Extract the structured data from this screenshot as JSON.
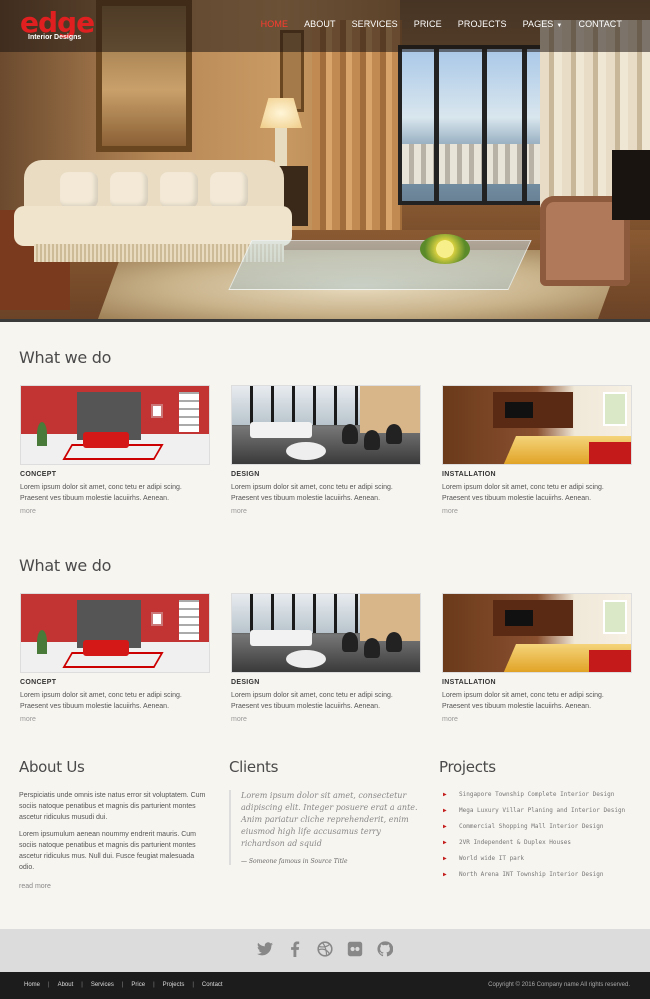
{
  "header": {
    "logo_main": "edge",
    "logo_sub": "Interior Designs",
    "nav": [
      {
        "label": "HOME",
        "active": true
      },
      {
        "label": "ABOUT",
        "active": false
      },
      {
        "label": "SERVICES",
        "active": false
      },
      {
        "label": "PRICE",
        "active": false
      },
      {
        "label": "PROJECTS",
        "active": false
      },
      {
        "label": "PAGES",
        "active": false,
        "dropdown": true
      },
      {
        "label": "CONTACT",
        "active": false
      }
    ]
  },
  "sections": [
    {
      "title": "What we do",
      "cards": [
        {
          "heading": "CONCEPT",
          "text": "Lorem ipsum dolor sit amet, conc tetu er adipi scing. Praesent ves tibuum molestie lacuiirhs. Aenean.",
          "more": "more"
        },
        {
          "heading": "DESIGN",
          "text": "Lorem ipsum dolor sit amet, conc tetu er adipi scing. Praesent ves tibuum molestie lacuiirhs. Aenean.",
          "more": "more"
        },
        {
          "heading": "INSTALLATION",
          "text": "Lorem ipsum dolor sit amet, conc tetu er adipi scing. Praesent ves tibuum molestie lacuiirhs. Aenean.",
          "more": "more"
        }
      ]
    },
    {
      "title": "What we do",
      "cards": [
        {
          "heading": "CONCEPT",
          "text": "Lorem ipsum dolor sit amet, conc tetu er adipi scing. Praesent ves tibuum molestie lacuiirhs. Aenean.",
          "more": "more"
        },
        {
          "heading": "DESIGN",
          "text": "Lorem ipsum dolor sit amet, conc tetu er adipi scing. Praesent ves tibuum molestie lacuiirhs. Aenean.",
          "more": "more"
        },
        {
          "heading": "INSTALLATION",
          "text": "Lorem ipsum dolor sit amet, conc tetu er adipi scing. Praesent ves tibuum molestie lacuiirhs. Aenean.",
          "more": "more"
        }
      ]
    }
  ],
  "about": {
    "title": "About Us",
    "p1": "Perspiciatis unde omnis iste natus error sit voluptatem. Cum sociis natoque penatibus et magnis dis parturient montes ascetur ridiculus musudi dui.",
    "p2": "Lorem ipsumulum aenean noummy endrerit mauris. Cum sociis natoque penatibus et magnis dis parturient montes ascetur ridiculus mus. Null dui. Fusce feugiat malesuada odio.",
    "more": "read more"
  },
  "clients": {
    "title": "Clients",
    "quote": "Lorem ipsum dolor sit amet, consectetur adipiscing elit. Integer posuere erat a ante. Anim pariatur cliche reprehenderit, enim eiusmod high life accusamus terry richardson ad squid",
    "cite": "— Someone famous in Source Title"
  },
  "projects": {
    "title": "Projects",
    "items": [
      "Singapore Township Complete Interior Design",
      "Mega Luxury Villar Planing and Interior Design",
      "Commercial Shopping Mall Interior Design",
      "2VR Independent & Duplex Houses",
      "World wide IT park",
      "North Arena INT Township Interior Design"
    ]
  },
  "social": [
    "twitter-icon",
    "facebook-icon",
    "dribbble-icon",
    "flickr-icon",
    "github-icon"
  ],
  "footer": {
    "links": [
      "Home",
      "About",
      "Services",
      "Price",
      "Projects",
      "Contact"
    ],
    "copyright": "Copyright © 2016 Company name All rights reserved."
  },
  "colors": {
    "accent": "#e02020",
    "footer_bg": "#1c1c1c",
    "social_bg": "#dcdcdc"
  }
}
